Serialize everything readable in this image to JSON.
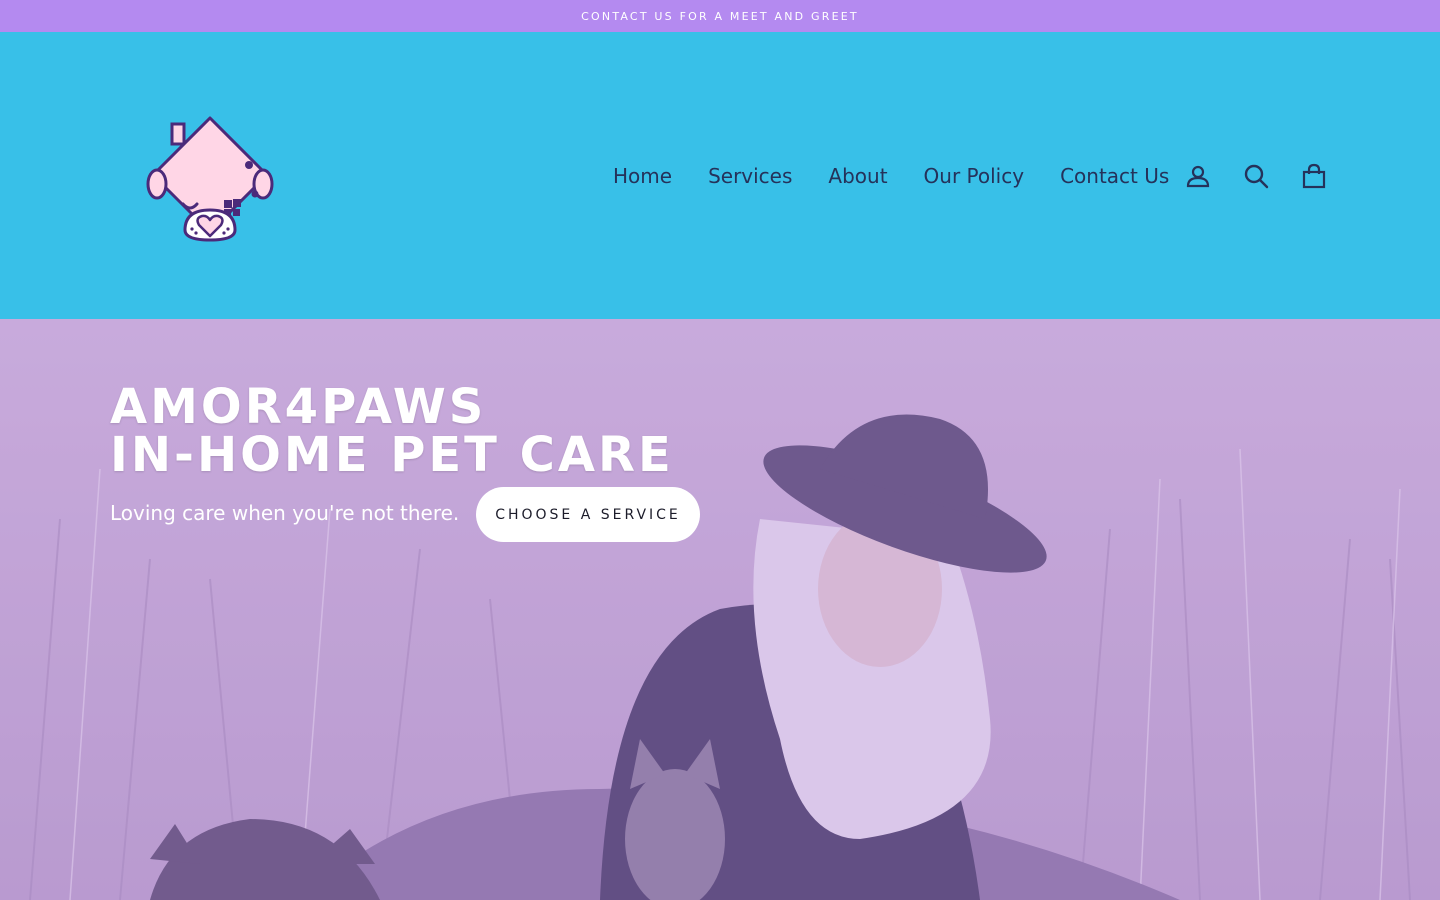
{
  "announcement": {
    "text": "CONTACT US FOR A MEET AND GREET"
  },
  "header": {
    "logo_name": "house-heart-logo",
    "nav": [
      {
        "label": "Home"
      },
      {
        "label": "Services"
      },
      {
        "label": "About"
      },
      {
        "label": "Our Policy"
      },
      {
        "label": "Contact Us"
      }
    ],
    "icons": [
      "account-icon",
      "search-icon",
      "cart-icon"
    ]
  },
  "hero": {
    "title_line1": "AMOR4PAWS",
    "title_line2": "IN-HOME PET CARE",
    "subtitle": "Loving care when you're not there.",
    "cta_label": "CHOOSE A SERVICE"
  },
  "colors": {
    "announcement_bg": "#b48af0",
    "header_bg": "#38c0e8",
    "nav_text": "#25325a",
    "hero_tint": "#c7a9d8"
  }
}
